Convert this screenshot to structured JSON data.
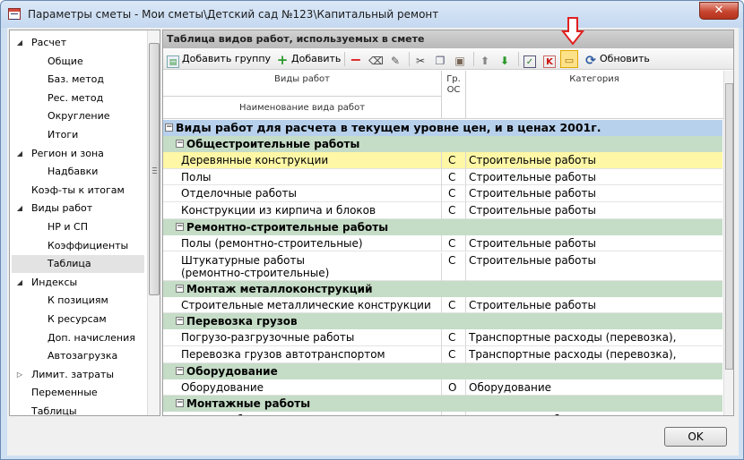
{
  "window": {
    "title": "Параметры сметы - Мои сметы\\Детский сад №123\\Капитальный ремонт",
    "close_symbol": "✕"
  },
  "sidebar": {
    "items": [
      {
        "label": "Расчет",
        "level": 0,
        "arrow": "expanded"
      },
      {
        "label": "Общие",
        "level": 1
      },
      {
        "label": "Баз. метод",
        "level": 1
      },
      {
        "label": "Рес. метод",
        "level": 1
      },
      {
        "label": "Округление",
        "level": 1
      },
      {
        "label": "Итоги",
        "level": 1
      },
      {
        "label": "Регион и зона",
        "level": 0,
        "arrow": "expanded"
      },
      {
        "label": "Надбавки",
        "level": 1
      },
      {
        "label": "Коэф-ты к итогам",
        "level": 0
      },
      {
        "label": "Виды работ",
        "level": 0,
        "arrow": "expanded"
      },
      {
        "label": "НР и СП",
        "level": 1
      },
      {
        "label": "Коэффициенты",
        "level": 1
      },
      {
        "label": "Таблица",
        "level": 1,
        "selected": true
      },
      {
        "label": "Индексы",
        "level": 0,
        "arrow": "expanded"
      },
      {
        "label": "К позициям",
        "level": 1
      },
      {
        "label": "К ресурсам",
        "level": 1
      },
      {
        "label": "Доп. начисления",
        "level": 1
      },
      {
        "label": "Автозагрузка",
        "level": 1
      },
      {
        "label": "Лимит. затраты",
        "level": 0,
        "arrow": "collapsed"
      },
      {
        "label": "Переменные",
        "level": 0
      },
      {
        "label": "Таблицы",
        "level": 0
      }
    ]
  },
  "panel": {
    "header": "Таблица видов работ, используемых в смете",
    "toolbar": {
      "add_group": "Добавить группу",
      "add": "Добавить",
      "refresh": "Обновить",
      "check_icon": "✓",
      "k_icon": "K"
    },
    "columns": {
      "work_types": "Виды работ",
      "gr": "Гр.",
      "os": "ОС",
      "category": "Категория",
      "name": "Наименование вида работ"
    },
    "rows": [
      {
        "type": "group0",
        "label": "Виды работ для расчета в текущем уровне цен, и в ценах 2001г."
      },
      {
        "type": "group1",
        "label": "Общестроительные работы"
      },
      {
        "type": "item",
        "name": "Деревянные конструкции",
        "os": "С",
        "category": "Строительные работы",
        "selected": true
      },
      {
        "type": "item",
        "name": "Полы",
        "os": "С",
        "category": "Строительные работы"
      },
      {
        "type": "item",
        "name": "Отделочные работы",
        "os": "С",
        "category": "Строительные работы"
      },
      {
        "type": "item",
        "name": "Конструкции из кирпича и блоков",
        "os": "С",
        "category": "Строительные работы"
      },
      {
        "type": "group1",
        "label": "Ремонтно-строительные работы"
      },
      {
        "type": "item",
        "name": "Полы (ремонтно-строительные)",
        "os": "С",
        "category": "Строительные работы"
      },
      {
        "type": "tall",
        "name": "Штукатурные работы",
        "name2": "(ремонтно-строительные)",
        "os": "С",
        "category": "Строительные работы"
      },
      {
        "type": "group1",
        "label": "Монтаж металлоконструкций"
      },
      {
        "type": "item",
        "name": "Строительные металлические конструкции",
        "os": "С",
        "category": "Строительные работы"
      },
      {
        "type": "group1",
        "label": "Перевозка грузов"
      },
      {
        "type": "item",
        "name": "Погрузо-разгрузочные работы",
        "os": "С",
        "category": "Транспортные расходы (перевозка),"
      },
      {
        "type": "item",
        "name": "Перевозка грузов автотранспортом",
        "os": "С",
        "category": "Транспортные расходы (перевозка),"
      },
      {
        "type": "group1",
        "label": "Оборудование"
      },
      {
        "type": "item",
        "name": "Оборудование",
        "os": "О",
        "category": "Оборудование"
      },
      {
        "type": "group1",
        "label": "Монтажные работы"
      },
      {
        "type": "item",
        "name": "Монтаж оборудования",
        "os": "М",
        "category": "Монтажные работы"
      }
    ]
  },
  "buttons": {
    "ok": "OK"
  },
  "colors": {
    "group0": "#b7d0ec",
    "group1": "#c5dcc7",
    "selected_row": "#fdf7a6",
    "highlight_arrow": "#e02020"
  }
}
